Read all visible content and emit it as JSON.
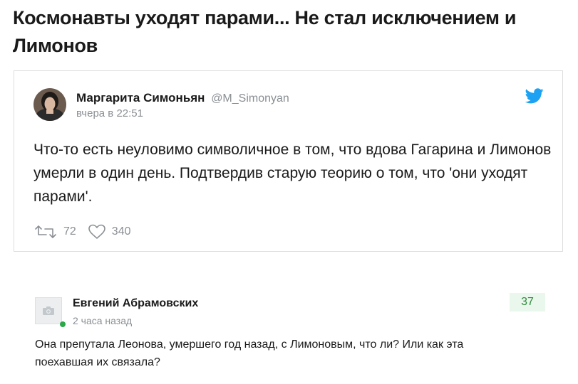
{
  "article": {
    "headline": "Космонавты уходят парами... Не стал исключением и Лимонов"
  },
  "tweet": {
    "author_name": "Маргарита Симоньян",
    "author_handle": "@M_Simonyan",
    "time": "вчера в 22:51",
    "text": "Что-то есть неуловимо символичное в том, что вдова Гагарина и Лимонов умерли в один день. Подтвердив старую теорию о том, что 'они уходят парами'.",
    "retweets": "72",
    "likes": "340",
    "brand_color": "#1da1f2"
  },
  "comment": {
    "author": "Евгений Абрамовских",
    "time": "2 часа назад",
    "rating": "37",
    "text": "Она препутала Леонова, умершего год назад, с Лимоновым, что ли? Или как эта поехавшая их связала?",
    "online_color": "#2ca84a"
  }
}
